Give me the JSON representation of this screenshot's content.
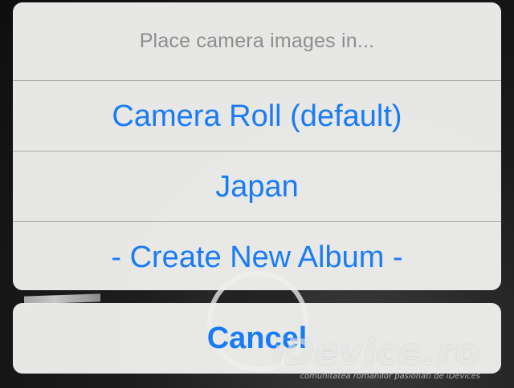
{
  "action_sheet": {
    "title": "Place camera images in...",
    "options": [
      {
        "label": "Camera Roll (default)"
      },
      {
        "label": "Japan"
      },
      {
        "label": "- Create New Album -"
      }
    ],
    "cancel_label": "Cancel"
  },
  "watermark": {
    "logo": "iDevice.ro",
    "tagline": "comunitatea romanilor pasionati de iDevices"
  },
  "colors": {
    "accent": "#1a7cf5",
    "title_text": "#8e8e8e",
    "sheet_background": "#eeeeec",
    "divider": "#a8a8a8"
  }
}
